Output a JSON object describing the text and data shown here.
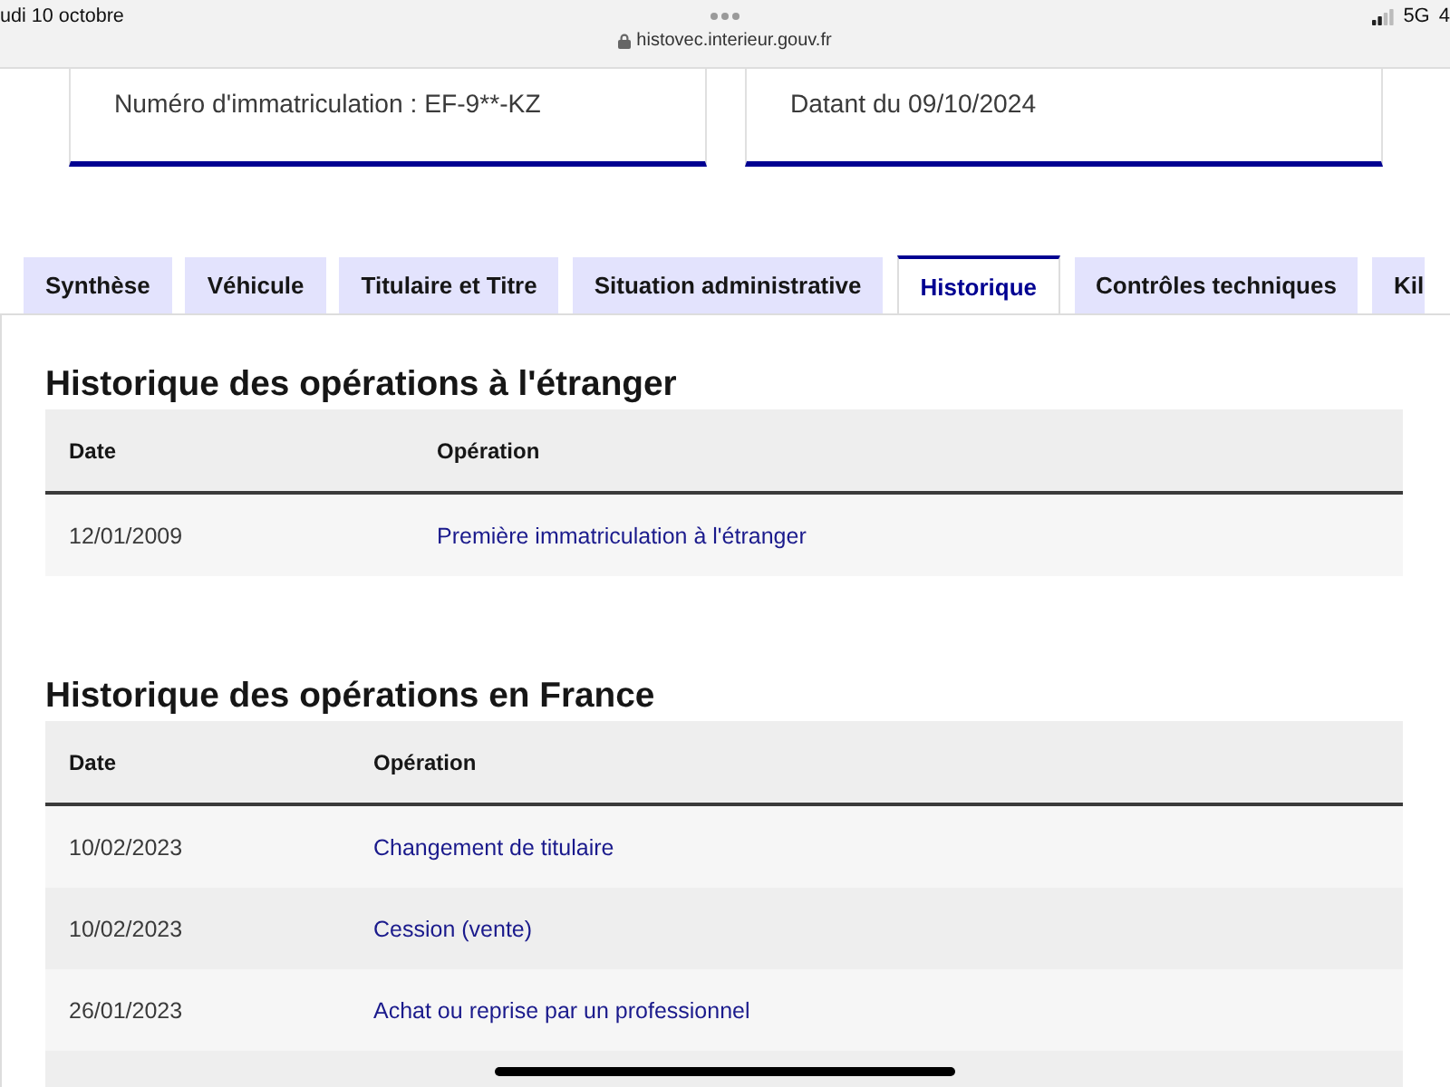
{
  "status_bar": {
    "date": "udi 10 octobre",
    "url": "histovec.interieur.gouv.fr",
    "network": "5G",
    "battery": "4"
  },
  "cards": [
    {
      "text": "Numéro d'immatriculation : EF-9**-KZ"
    },
    {
      "text": "Datant du 09/10/2024"
    }
  ],
  "tabs": [
    {
      "label": "Synthèse",
      "selected": false
    },
    {
      "label": "Véhicule",
      "selected": false
    },
    {
      "label": "Titulaire et Titre",
      "selected": false
    },
    {
      "label": "Situation administrative",
      "selected": false
    },
    {
      "label": "Historique",
      "selected": true
    },
    {
      "label": "Contrôles techniques",
      "selected": false
    },
    {
      "label": "Kil",
      "selected": false
    }
  ],
  "sections": [
    {
      "title": "Historique des opérations à l'étranger",
      "columns": [
        "Date",
        "Opération"
      ],
      "rows": [
        {
          "date": "12/01/2009",
          "operation": "Première immatriculation à l'étranger"
        }
      ]
    },
    {
      "title": "Historique des opérations en France",
      "columns": [
        "Date",
        "Opération"
      ],
      "rows": [
        {
          "date": "10/02/2023",
          "operation": "Changement de titulaire"
        },
        {
          "date": "10/02/2023",
          "operation": "Cession (vente)"
        },
        {
          "date": "26/01/2023",
          "operation": "Achat ou reprise par un professionnel"
        }
      ]
    }
  ]
}
